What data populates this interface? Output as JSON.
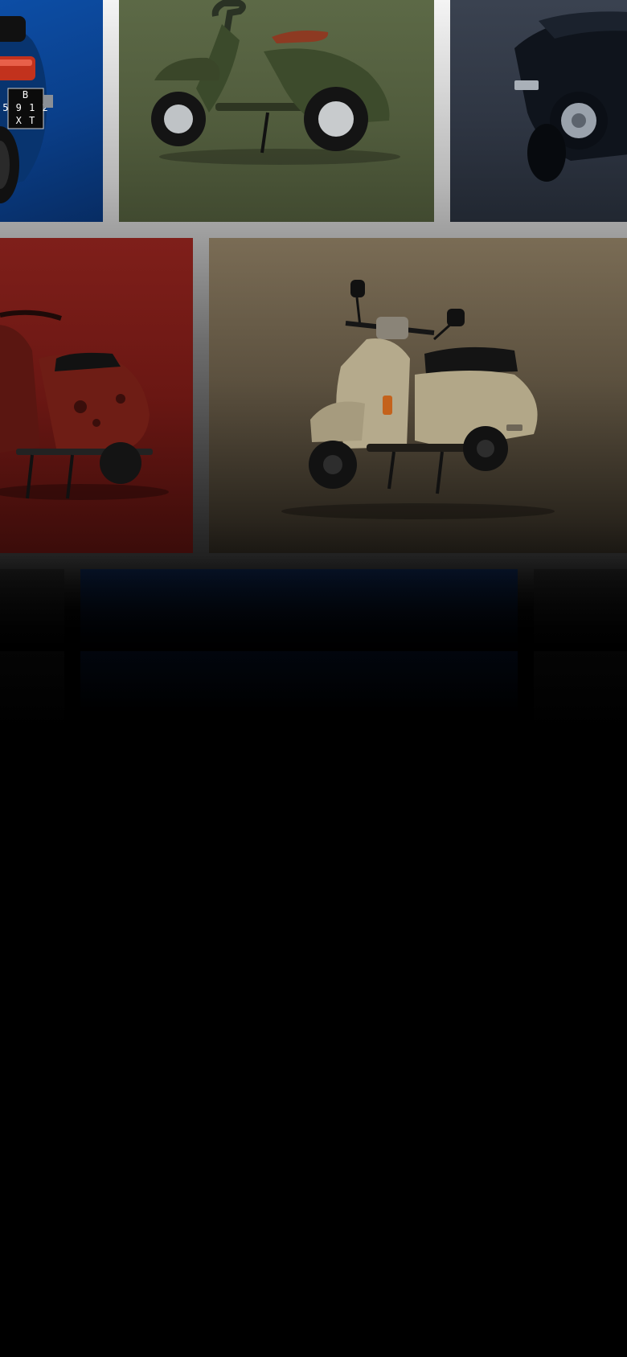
{
  "gallery": {
    "tiles": [
      {
        "id": "blue-scooter",
        "background": "#0a3f8a",
        "plate": {
          "line1": "B",
          "line2": "5 9 1 2",
          "line3": "X T"
        }
      },
      {
        "id": "green-scooter",
        "background": "#505b3c"
      },
      {
        "id": "black-scooter",
        "background": "#2f3643"
      },
      {
        "id": "red-scooter",
        "background": "#6a1713"
      },
      {
        "id": "beige-scooter",
        "background": "#5c513f"
      },
      {
        "id": "dark-tile-left",
        "background": "#0b0b0b"
      },
      {
        "id": "navy-tile",
        "background": "#07142a"
      },
      {
        "id": "dark-tile-right",
        "background": "#0b0b0b"
      }
    ]
  },
  "colors": {
    "page_bg_top": "#f4f4f4",
    "page_bg_bottom": "#000000"
  }
}
